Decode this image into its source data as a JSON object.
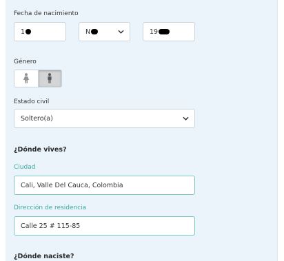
{
  "birth": {
    "label": "Fecha de nacimiento",
    "day_visible": "1",
    "month_visible": "N",
    "year_visible": "19"
  },
  "gender": {
    "label": "Género",
    "options": [
      "female",
      "male"
    ],
    "selected": "male"
  },
  "marital": {
    "label": "Estado civil",
    "value": "Soltero(a)"
  },
  "residence": {
    "heading": "¿Dónde vives?",
    "city_label": "Ciudad",
    "city_value": "Cali, Valle Del Cauca, Colombia",
    "address_label": "Dirección de residencia",
    "address_value": "Calle 25 # 115-85"
  },
  "birthplace": {
    "heading": "¿Dónde naciste?"
  },
  "colors": {
    "panel_bg": "#ebf4fb",
    "accent": "#3aa9a0",
    "field_border": "#c9d4dd",
    "focus_border": "#7cc7c0"
  }
}
